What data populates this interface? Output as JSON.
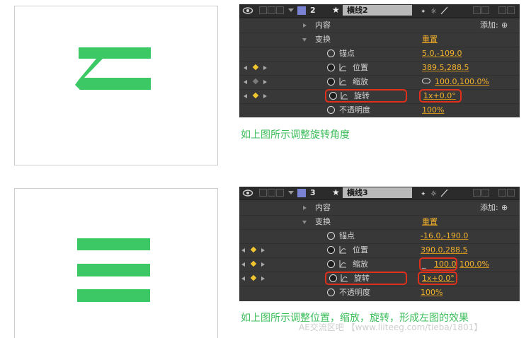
{
  "panel1": {
    "layer_number": "2",
    "layer_name": "横线2",
    "rows": {
      "content_label": "内容",
      "add_label": "添加:",
      "transform_label": "变换",
      "reset_label": "重置",
      "anchor_label": "锚点",
      "anchor_value": "5.0,-109.0",
      "position_label": "位置",
      "position_value": "389.5,288.5",
      "scale_label": "缩放",
      "scale_value": "100.0,100.0%",
      "rotation_label": "旋转",
      "rotation_value": "1x+0.0°",
      "opacity_label": "不透明度",
      "opacity_value": "100%"
    },
    "caption": "如上图所示调整旋转角度"
  },
  "panel2": {
    "layer_number": "3",
    "layer_name": "横线3",
    "rows": {
      "content_label": "内容",
      "add_label": "添加:",
      "transform_label": "变换",
      "reset_label": "重置",
      "anchor_label": "锚点",
      "anchor_value": "-16.0,-190.0",
      "position_label": "位置",
      "position_value": "390.0,288.5",
      "scale_label": "缩放",
      "scale_value_x": "100.0",
      "scale_value_y": "100.0%",
      "rotation_label": "旋转",
      "rotation_value": "1x+0.0°",
      "opacity_label": "不透明度",
      "opacity_value": "100%"
    },
    "caption": "如上图所示调整位置，缩放，旋转，形成左图的效果"
  },
  "watermark": "AE交流区吧 【www.liiteeg.com/tieba/1801】",
  "colors": {
    "accent_green": "#3cc864",
    "value_orange": "#f3b12d",
    "highlight_red": "#e0301c",
    "layer_label": "#7a82d4"
  }
}
